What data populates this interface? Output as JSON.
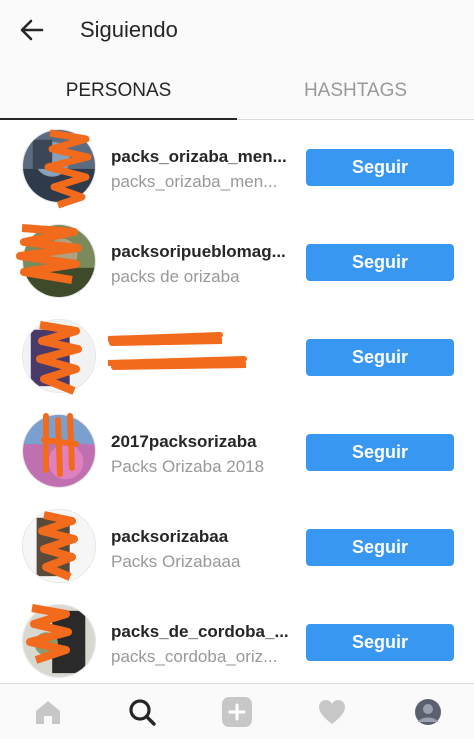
{
  "header": {
    "title": "Siguiendo",
    "back_icon": "arrow-left-icon"
  },
  "tabs": [
    {
      "label": "PERSONAS",
      "active": true
    },
    {
      "label": "HASHTAGS",
      "active": false
    }
  ],
  "accounts": [
    {
      "username": "packs_orizaba_men...",
      "fullname": "packs_orizaba_men...",
      "button": "Seguir"
    },
    {
      "username": "packsoripueblomag...",
      "fullname": "packs de orizaba",
      "button": "Seguir"
    },
    {
      "username": "",
      "fullname": "",
      "button": "Seguir"
    },
    {
      "username": "2017packsorizaba",
      "fullname": "Packs Orizaba 2018",
      "button": "Seguir"
    },
    {
      "username": "packsorizabaa",
      "fullname": "Packs Orizabaaa",
      "button": "Seguir"
    },
    {
      "username": "packs_de_cordoba_...",
      "fullname": "packs_cordoba_oriz...",
      "button": "Seguir"
    }
  ],
  "bottom_nav": [
    "home-icon",
    "search-icon",
    "add-icon",
    "heart-icon",
    "profile-avatar"
  ],
  "colors": {
    "accent": "#3897f0",
    "scribble": "#f26a1b",
    "secondary_text": "#999999"
  }
}
